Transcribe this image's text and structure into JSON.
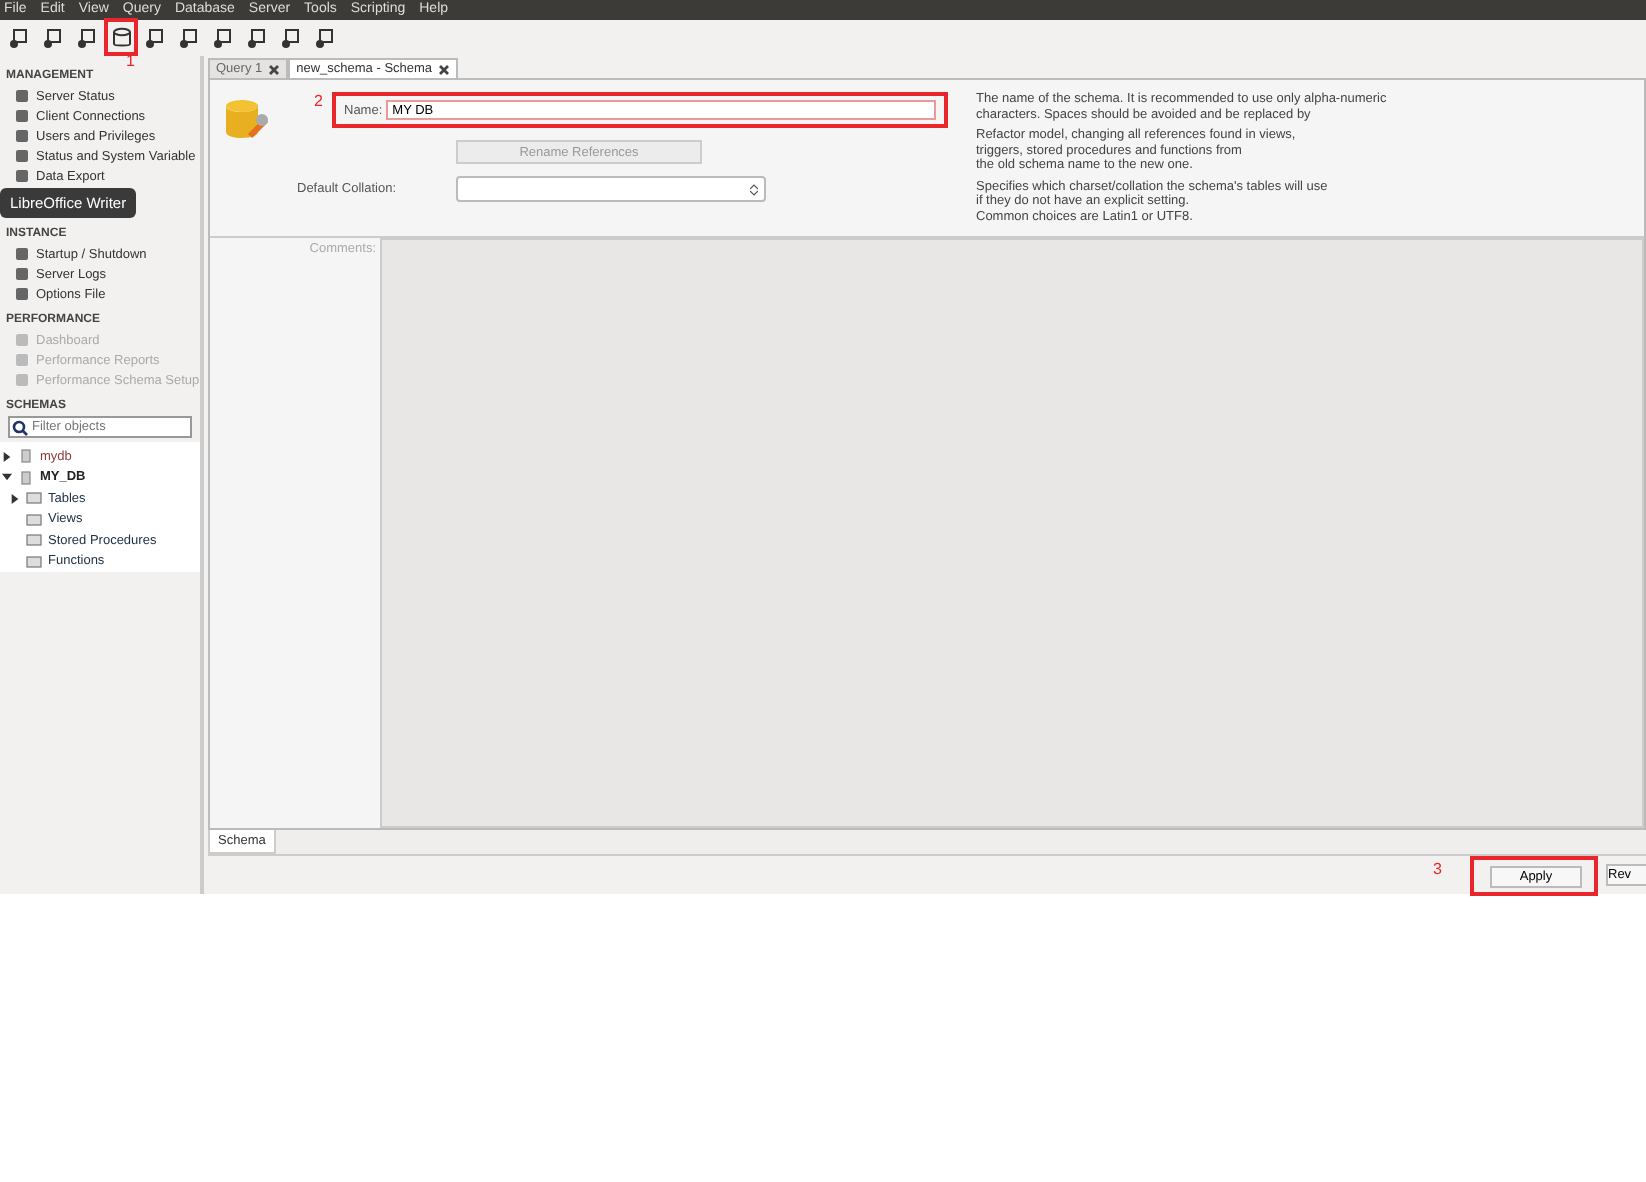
{
  "menu": [
    "File",
    "Edit",
    "View",
    "Query",
    "Database",
    "Server",
    "Tools",
    "Scripting",
    "Help"
  ],
  "toolbar": {
    "highlight_label": "1"
  },
  "sidebar": {
    "sections": [
      {
        "title": "MANAGEMENT",
        "items": [
          {
            "label": "Server Status",
            "disabled": false
          },
          {
            "label": "Client Connections",
            "disabled": false
          },
          {
            "label": "Users and Privileges",
            "disabled": false
          },
          {
            "label": "Status and System Variable",
            "disabled": false
          },
          {
            "label": "Data Export",
            "disabled": false
          }
        ],
        "tooltip": "LibreOffice Writer"
      },
      {
        "title": "INSTANCE",
        "items": [
          {
            "label": "Startup / Shutdown",
            "disabled": false
          },
          {
            "label": "Server Logs",
            "disabled": false
          },
          {
            "label": "Options File",
            "disabled": false
          }
        ]
      },
      {
        "title": "PERFORMANCE",
        "items": [
          {
            "label": "Dashboard",
            "disabled": true
          },
          {
            "label": "Performance Reports",
            "disabled": true
          },
          {
            "label": "Performance Schema Setup",
            "disabled": true
          }
        ]
      }
    ],
    "schemas": {
      "title": "SCHEMAS",
      "filter_placeholder": "Filter objects",
      "tree": [
        {
          "label": "mydb",
          "expanded": false,
          "bold": false
        },
        {
          "label": "MY_DB",
          "expanded": true,
          "bold": true,
          "children": [
            {
              "label": "Tables",
              "expandable": true
            },
            {
              "label": "Views",
              "expandable": false
            },
            {
              "label": "Stored Procedures",
              "expandable": false
            },
            {
              "label": "Functions",
              "expandable": false
            }
          ]
        }
      ]
    }
  },
  "tabs": [
    {
      "label": "Query 1",
      "selected": false
    },
    {
      "label": "new_schema - Schema",
      "selected": true
    }
  ],
  "form": {
    "annotation": "2",
    "name_label": "Name:",
    "name_value": "MY DB",
    "rename_button": "Rename References",
    "collation_label": "Default Collation:",
    "comments_label": "Comments:",
    "help": [
      [
        "The name of the schema. It is recommended to use only alpha-numeric",
        "characters. Spaces should be avoided and be replaced by"
      ],
      [
        "Refactor model, changing all references found in views,",
        "triggers, stored procedures and functions from",
        "the old schema name to the new one."
      ],
      [
        "Specifies which charset/collation the schema's tables will use",
        "if they do not have an explicit setting.",
        "Common choices are Latin1 or UTF8."
      ]
    ]
  },
  "bottom_tabs": [
    {
      "label": "Schema",
      "selected": true
    }
  ],
  "footer": {
    "annotation": "3",
    "apply": "Apply",
    "revert": "Rev"
  }
}
